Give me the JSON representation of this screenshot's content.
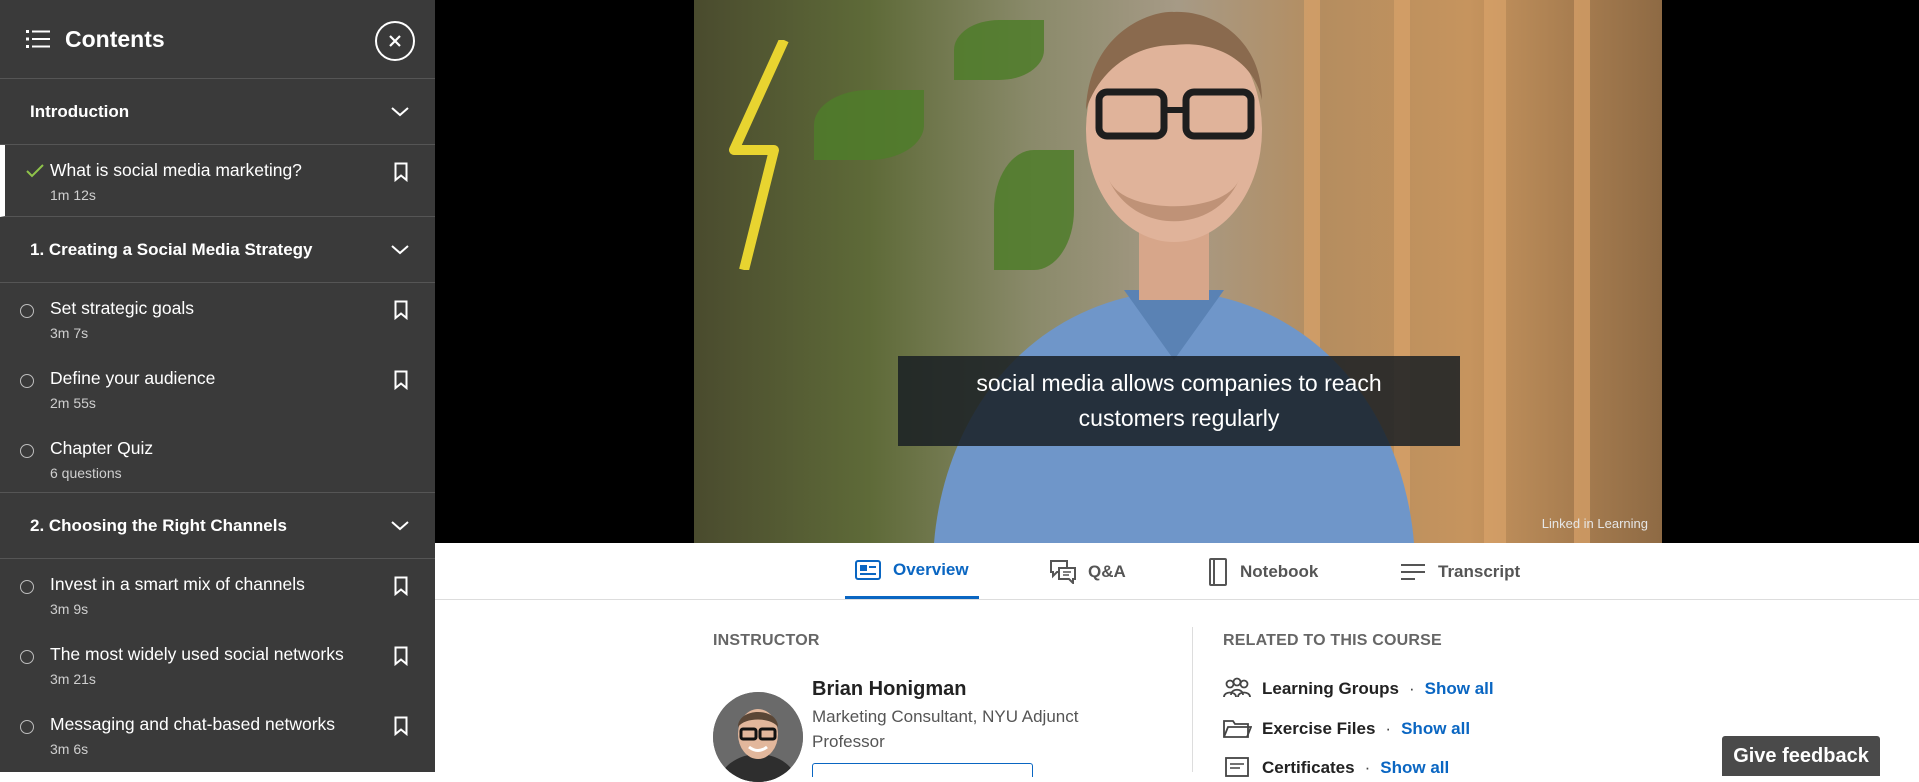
{
  "sidebar": {
    "title": "Contents",
    "sections": [
      {
        "title": "Introduction",
        "items": [
          {
            "title": "What is social media marketing?",
            "meta": "1m 12s",
            "status": "completed"
          }
        ]
      },
      {
        "title": "1. Creating a Social Media Strategy",
        "items": [
          {
            "title": "Set strategic goals",
            "meta": "3m 7s",
            "status": "not-started"
          },
          {
            "title": "Define your audience",
            "meta": "2m 55s",
            "status": "not-started"
          },
          {
            "title": "Chapter Quiz",
            "meta": "6 questions",
            "status": "not-started"
          }
        ]
      },
      {
        "title": "2. Choosing the Right Channels",
        "items": [
          {
            "title": "Invest in a smart mix of channels",
            "meta": "3m 9s",
            "status": "not-started"
          },
          {
            "title": "The most widely used social networks",
            "meta": "3m 21s",
            "status": "not-started"
          },
          {
            "title": "Messaging and chat-based networks",
            "meta": "3m 6s",
            "status": "not-started"
          }
        ]
      }
    ]
  },
  "player": {
    "caption_line1": "social media allows companies to reach",
    "caption_line2": "customers regularly",
    "watermark": "Linked in Learning"
  },
  "tabs": [
    {
      "label": "Overview",
      "icon": "overview-icon",
      "active": true
    },
    {
      "label": "Q&A",
      "icon": "qa-icon",
      "active": false
    },
    {
      "label": "Notebook",
      "icon": "notebook-icon",
      "active": false
    },
    {
      "label": "Transcript",
      "icon": "transcript-icon",
      "active": false
    }
  ],
  "instructor": {
    "label": "INSTRUCTOR",
    "name": "Brian Honigman",
    "role": "Marketing Consultant, NYU Adjunct Professor"
  },
  "related": {
    "label": "RELATED TO THIS COURSE",
    "rows": [
      {
        "name": "Learning Groups",
        "link": "Show all",
        "icon": "groups-icon"
      },
      {
        "name": "Exercise Files",
        "link": "Show all",
        "icon": "folder-icon"
      },
      {
        "name": "Certificates",
        "link": "Show all",
        "icon": "certificate-icon"
      }
    ]
  },
  "feedback_label": "Give feedback",
  "colors": {
    "accent": "#0a66c2",
    "sidebar_bg": "#3a3a3a",
    "check": "#8fc34a"
  }
}
